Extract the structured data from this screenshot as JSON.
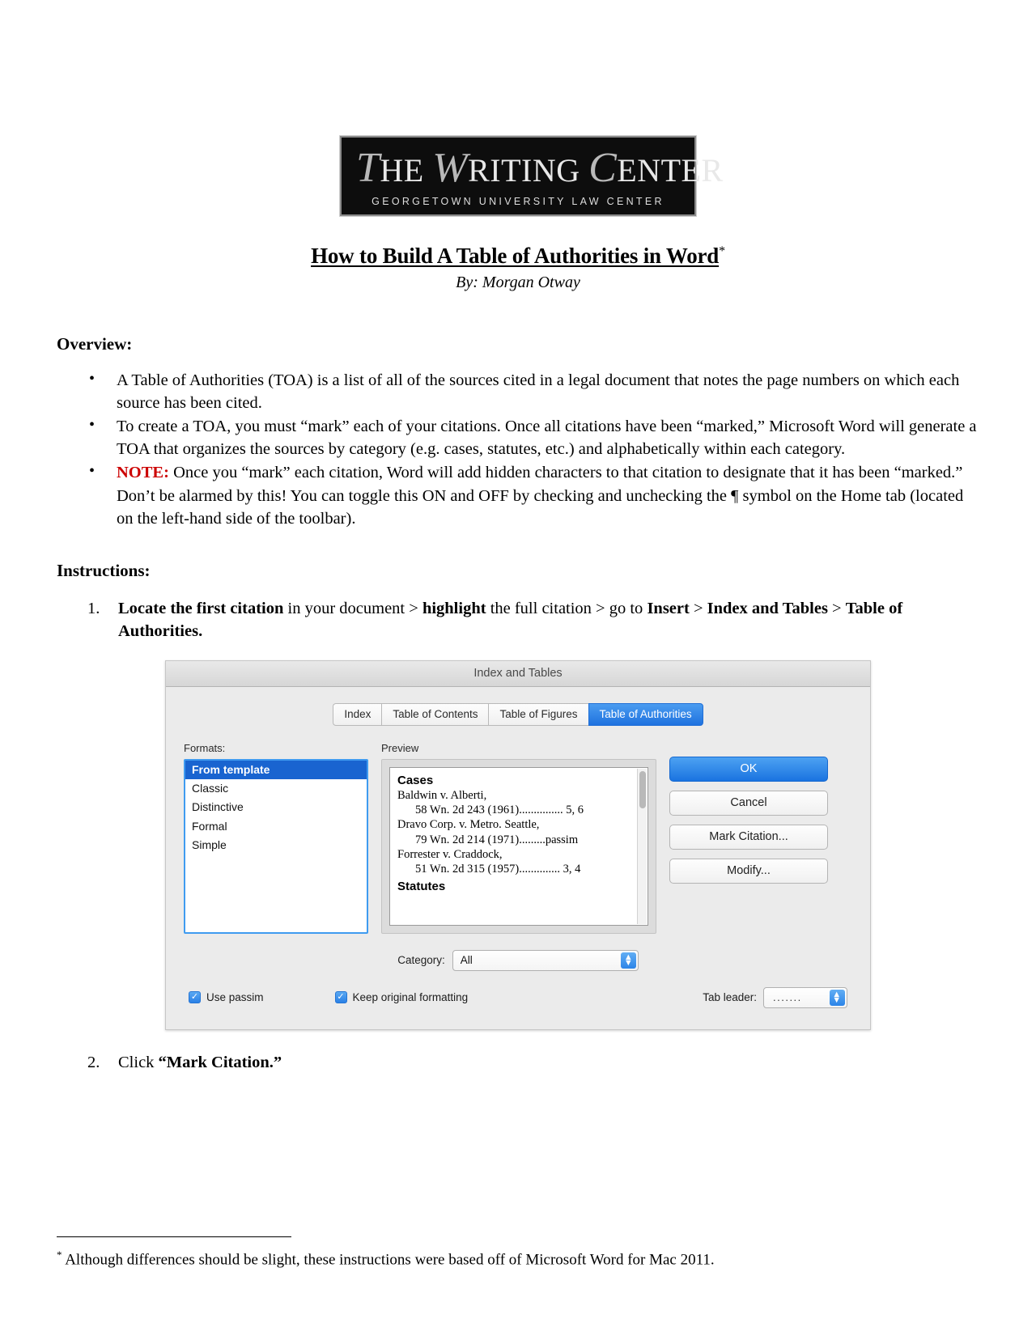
{
  "logo": {
    "line1_parts": [
      "T",
      "HE ",
      "W",
      "RITING ",
      "C",
      "ENTER"
    ],
    "line1_t": "T",
    "line1_he": "HE",
    "line1_w": "W",
    "line1_riting": "RITING",
    "line1_c": "C",
    "line1_enter": "ENTER",
    "subtitle": "GEORGETOWN UNIVERSITY LAW CENTER"
  },
  "title": {
    "text": "How to Build A Table of Authorities in Word",
    "footnote_marker": "*",
    "byline": "By: Morgan Otway"
  },
  "overview": {
    "heading": "Overview:",
    "bullets": [
      "A Table of Authorities (TOA) is a list of all of the sources cited in a legal document that notes the page numbers on which each source has been cited.",
      "To create a TOA, you must “mark” each of your citations. Once all citations have been “marked,” Microsoft Word will generate a TOA that organizes the sources by category (e.g. cases, statutes, etc.) and alphabetically within each category.",
      "Once you “mark” each citation, Word will add hidden characters to that citation to designate that it has been “marked.” Don’t be alarmed by this! You can toggle this ON and OFF by checking and unchecking the ¶ symbol on the Home tab (located on the left-hand side of the toolbar)."
    ],
    "note_label": "NOTE:"
  },
  "instructions": {
    "heading": "Instructions:",
    "steps": [
      {
        "number": "1.",
        "segments": [
          {
            "text": "Locate the first citation",
            "bold": true
          },
          {
            "text": " in your document > ",
            "bold": false
          },
          {
            "text": "highlight",
            "bold": true
          },
          {
            "text": " the full citation > go to ",
            "bold": false
          },
          {
            "text": "Insert",
            "bold": true
          },
          {
            "text": " > ",
            "bold": false
          },
          {
            "text": "Index and Tables",
            "bold": true
          },
          {
            "text": " > ",
            "bold": false
          },
          {
            "text": "Table of Authorities.",
            "bold": true
          }
        ]
      },
      {
        "number": "2.",
        "segments": [
          {
            "text": "Click ",
            "bold": false
          },
          {
            "text": "“Mark Citation.”",
            "bold": true
          }
        ]
      }
    ],
    "step1_p1": "Locate the first citation",
    "step1_p2": " in your document > ",
    "step1_p3": "highlight",
    "step1_p4": " the full citation > go to ",
    "step1_p5": "Insert",
    "step1_p6": " > ",
    "step1_p7": "Index and Tables",
    "step1_p8": " > ",
    "step1_p9": "Table of Authorities.",
    "step1_num": "1.",
    "step2_num": "2.",
    "step2_p1": "Click ",
    "step2_p2": "“Mark Citation.”"
  },
  "dialog": {
    "title": "Index and Tables",
    "tabs": [
      {
        "label": "Index",
        "active": false
      },
      {
        "label": "Table of Contents",
        "active": false
      },
      {
        "label": "Table of Figures",
        "active": false
      },
      {
        "label": "Table of Authorities",
        "active": true
      }
    ],
    "tab0": "Index",
    "tab1": "Table of Contents",
    "tab2": "Table of Figures",
    "tab3": "Table of Authorities",
    "formats_label": "Formats:",
    "formats": [
      "From template",
      "Classic",
      "Distinctive",
      "Formal",
      "Simple"
    ],
    "format0": "From template",
    "format1": "Classic",
    "format2": "Distinctive",
    "format3": "Formal",
    "format4": "Simple",
    "selected_format": "From template",
    "preview_label": "Preview",
    "preview": {
      "heading": "Cases",
      "lines": [
        "Baldwin v. Alberti,",
        "58 Wn. 2d 243 (1961)............... 5, 6",
        "Dravo Corp. v. Metro. Seattle,",
        "79 Wn. 2d 214 (1971).........passim",
        "Forrester v. Craddock,",
        "51 Wn. 2d 315 (1957).............. 3, 4"
      ],
      "line0": "Baldwin v. Alberti,",
      "line1": "58 Wn. 2d 243 (1961)............... 5, 6",
      "line2": "Dravo Corp. v. Metro. Seattle,",
      "line3": "79 Wn. 2d 214 (1971).........passim",
      "line4": "Forrester v. Craddock,",
      "line5": "51 Wn. 2d 315 (1957).............. 3, 4",
      "next_heading": "Statutes"
    },
    "buttons": {
      "ok": "OK",
      "cancel": "Cancel",
      "mark_citation": "Mark Citation...",
      "modify": "Modify..."
    },
    "category_label": "Category:",
    "category_value": "All",
    "use_passim_label": "Use passim",
    "keep_formatting_label": "Keep original formatting",
    "tab_leader_label": "Tab leader:",
    "tab_leader_value": ".......",
    "checkmark": "✓",
    "stepper_up": "▲",
    "stepper_down": "▼"
  },
  "footnote": {
    "marker": "*",
    "text": " Although differences should be slight, these instructions were based off of Microsoft Word for Mac 2011."
  },
  "colors": {
    "note_red": "#cc0000",
    "accent_blue": "#1f72df",
    "selection_blue": "#1964d0"
  }
}
